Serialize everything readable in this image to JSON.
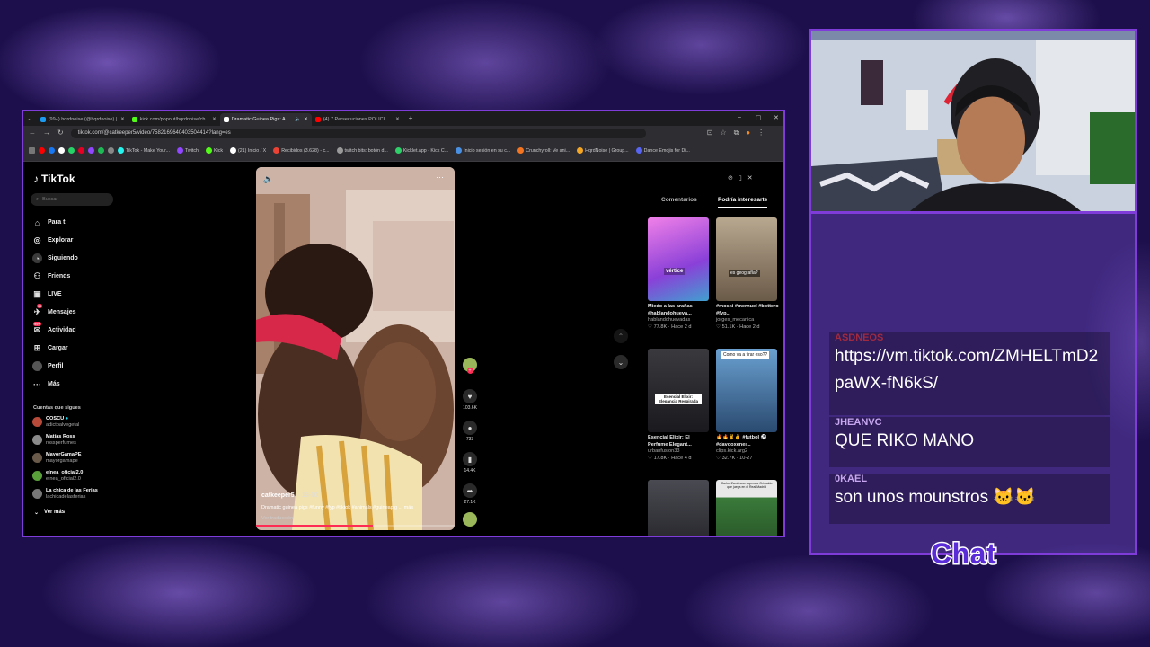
{
  "browser": {
    "tabs": [
      {
        "label": "(99+) hqrdnoise (@hqrdnoise) | ",
        "color": "#1d9bf0"
      },
      {
        "label": "kick.com/popout/hqrdnoise/ch",
        "color": "#53fc18"
      },
      {
        "label": "Dramatic Guinea Pigs: A F...",
        "color": "#ffffff"
      },
      {
        "label": "(4) 7 Persecuciones POLICIALES",
        "color": "#ff0000"
      }
    ],
    "url": "tiktok.com/@catkeeper5/video/7582169640403504414?lang=es",
    "bookmarks": [
      {
        "label": "TikTok - Make Your...",
        "color": "#25f4ee"
      },
      {
        "label": "Twitch",
        "color": "#9146ff"
      },
      {
        "label": "Kick",
        "color": "#53fc18"
      },
      {
        "label": "(21) Inicio / X",
        "color": "#ffffff"
      },
      {
        "label": "Recibidos (3.628) - c...",
        "color": "#ea4335"
      },
      {
        "label": "twitch bits: botón d...",
        "color": "#9a9a9a"
      },
      {
        "label": "Kicklet.app - Kick C...",
        "color": "#2fd06a"
      },
      {
        "label": "Inicio sesión en su c...",
        "color": "#4a90e2"
      },
      {
        "label": "Crunchyroll: Ve ani...",
        "color": "#f47521"
      },
      {
        "label": "HqrdNoise | Group...",
        "color": "#f5a623"
      },
      {
        "label": "Dance Emojis for Di...",
        "color": "#5865f2"
      }
    ]
  },
  "tiktok": {
    "logo": "TikTok",
    "search_placeholder": "Buscar",
    "nav": [
      {
        "label": "Para ti",
        "icon": "home-icon"
      },
      {
        "label": "Explorar",
        "icon": "compass-icon"
      },
      {
        "label": "Siguiendo",
        "icon": "following-icon"
      },
      {
        "label": "Friends",
        "icon": "friends-icon"
      },
      {
        "label": "LIVE",
        "icon": "live-icon"
      },
      {
        "label": "Mensajes",
        "icon": "messages-icon",
        "badge": "99"
      },
      {
        "label": "Actividad",
        "icon": "activity-icon",
        "badge": "99+"
      },
      {
        "label": "Cargar",
        "icon": "upload-icon"
      },
      {
        "label": "Perfil",
        "icon": "profile-icon"
      },
      {
        "label": "Más",
        "icon": "more-icon"
      }
    ],
    "following_title": "Cuentas que sigues",
    "following": [
      {
        "name": "COSCU",
        "handle": "adictoalvegetal",
        "color": "#b84a3a"
      },
      {
        "name": "Matías Ross",
        "handle": "rossperfumes",
        "color": "#8a8a8a"
      },
      {
        "name": "MayorGamaPE",
        "handle": "mayorgamape",
        "color": "#6a5a4a"
      },
      {
        "name": "elnea_oficial2.0",
        "handle": "elnea_oficial2.0",
        "color": "#5aa03a"
      },
      {
        "name": "La chica de las Ferias",
        "handle": "lachicadelasferias",
        "color": "#777777"
      }
    ],
    "see_more": "Ver más",
    "video": {
      "author": "catkeeper5",
      "time": "· 18-10",
      "description": "Dramatic guinea pigs #funny #fyp #tiktok #animals #guineapig ... más",
      "translate": "Ver traducción",
      "progress": 0.59,
      "likes": "103.6K",
      "comments": "733",
      "saves": "14.4K",
      "shares": "27.1K"
    },
    "panel_tabs": [
      "Comentarios",
      "Podría interesarte"
    ],
    "suggestions": [
      {
        "title": "Miedo a las arañas #hablandohueva...",
        "user": "hablandohuevadas",
        "meta": "♡ 77.8K · Hace 2 d",
        "overlay": "vértice",
        "color": "#c03ad8"
      },
      {
        "title": "#moski #mernuel #bottero #fyp...",
        "user": "jorges_mecanica",
        "meta": "♡ 51.1K · Hace 2 d",
        "overlay": "es geografía?",
        "color": "#7a6a58"
      },
      {
        "title": "Esencial Elixir: El Perfume Elegant...",
        "user": "urbanfusion33",
        "meta": "♡ 17.8K · Hace 4 d",
        "overlay": "Esencial Elixir: Elegancia Respirada",
        "color": "#2a2a2e"
      },
      {
        "title": "🔥🔥✌️✌️ #futbol ⚽ #davooxeneı...",
        "user": "clips.kick.arg2",
        "meta": "♡ 32.7K · 10-27",
        "overlay": "Como va a tirar eso??",
        "color": "#3a6a9a"
      },
      {
        "title": "",
        "user": "",
        "meta": "",
        "overlay": "",
        "color": "#2a2a30"
      },
      {
        "title": "",
        "user": "",
        "meta": "",
        "overlay": "Carlos Zambrano supera a Grimaldo que juega en el Real Madrid",
        "color": "#3a7a3a"
      }
    ]
  },
  "chat": {
    "title": "Chat",
    "messages": [
      {
        "user": "ASDNEOS",
        "text": "https://vm.tiktok.com/ZMHELTmD2paWX-fN6kS/",
        "color": "#a02a40"
      },
      {
        "user": "JHEANVC",
        "text": "QUE RIKO MANO",
        "color": "#c8a8f0"
      },
      {
        "user": "0KAEL",
        "text": "son unos mounstros 🐱🐱",
        "color": "#c8a8f0"
      }
    ]
  }
}
